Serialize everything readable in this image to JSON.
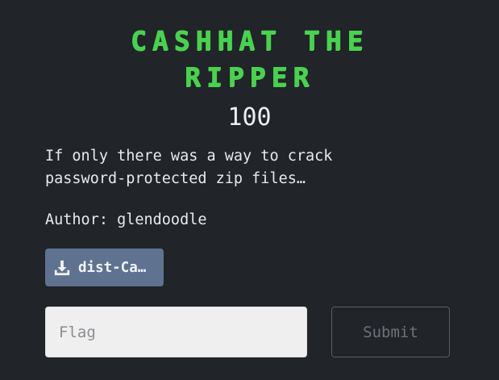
{
  "challenge": {
    "title_line1": "CASHHAT THE",
    "title_line2": "RIPPER",
    "points": "100",
    "description_line1": "If only there was a way to crack",
    "description_line2": "password-protected zip files…",
    "author": "Author: glendoodle",
    "file_label": "dist-Ca…",
    "file_icon": "download-icon"
  },
  "form": {
    "flag_placeholder": "Flag",
    "flag_value": "",
    "submit_label": "Submit"
  },
  "colors": {
    "background": "#212428",
    "title": "#49d14f",
    "file_button": "#5f7290",
    "input_background": "#efefef"
  }
}
